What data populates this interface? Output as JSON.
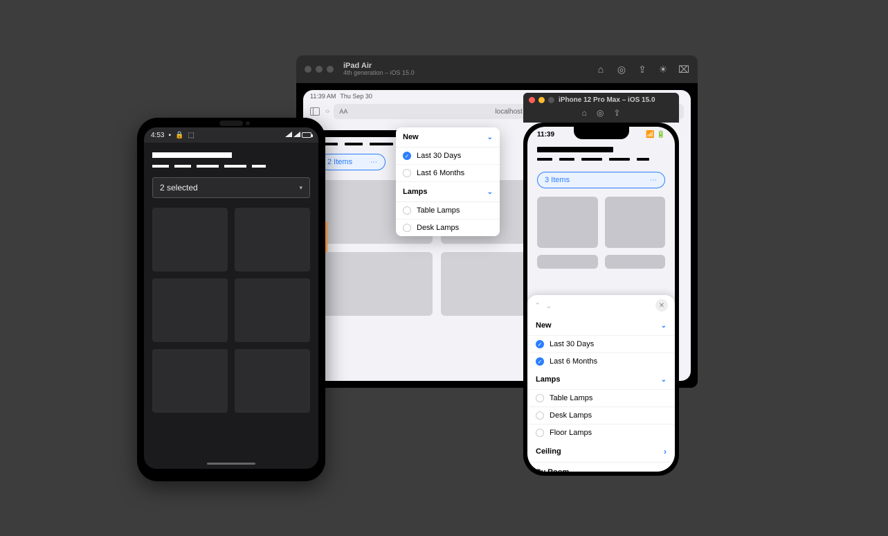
{
  "ipad": {
    "sim_title": "iPad Air",
    "sim_subtitle": "4th generation – iOS 15.0",
    "status_time": "11:39 AM",
    "status_date": "Thu Sep 30",
    "url_aa": "AA",
    "url_text": "localhost",
    "filter_pill": "2 Items",
    "popover": {
      "section1": "New",
      "s1_opt1": "Last 30 Days",
      "s1_opt2": "Last 6 Months",
      "section2": "Lamps",
      "s2_opt1": "Table Lamps",
      "s2_opt2": "Desk Lamps"
    }
  },
  "iphone": {
    "sim_title": "iPhone 12 Pro Max – iOS 15.0",
    "status_time": "11:39",
    "filter_pill": "3 Items",
    "sheet": {
      "section1": "New",
      "s1_opt1": "Last 30 Days",
      "s1_opt2": "Last 6 Months",
      "section2": "Lamps",
      "s2_opt1": "Table Lamps",
      "s2_opt2": "Desk Lamps",
      "s2_opt3": "Floor Lamps",
      "section3": "Ceiling",
      "section4": "By Room"
    }
  },
  "android": {
    "status_time": "4:53",
    "select_label": "2 selected"
  }
}
